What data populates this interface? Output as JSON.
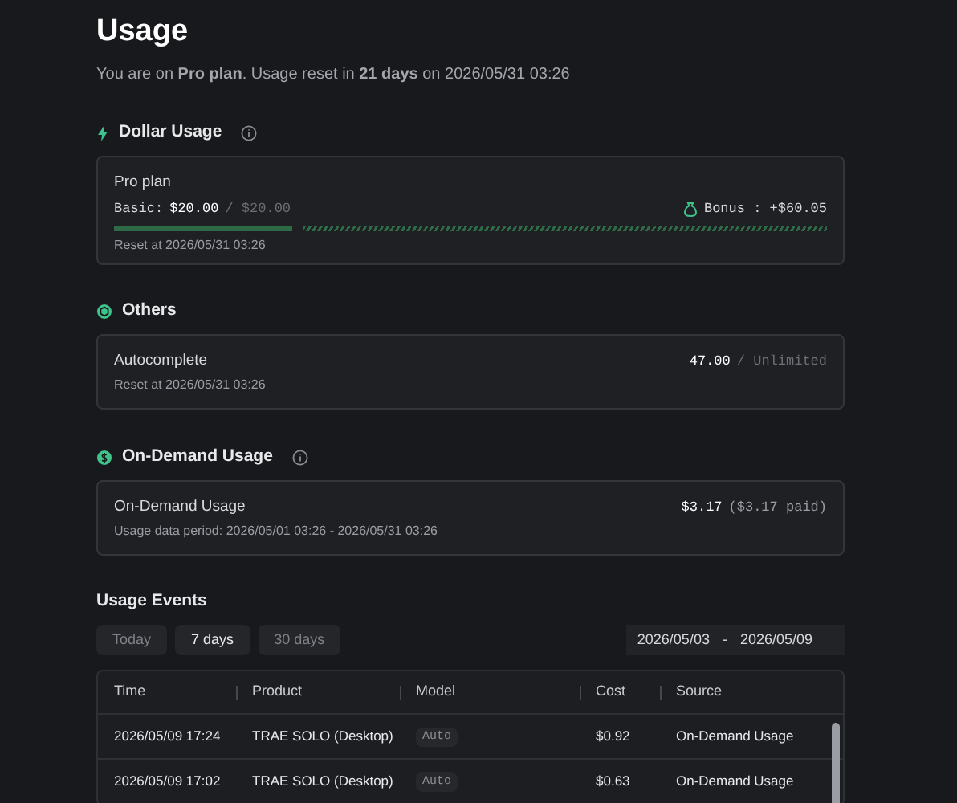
{
  "title": "Usage",
  "subtitle": "You are on **Pro plan**. Usage reset in **21 days** on 2026/05/31 03:26",
  "dollar_usage": {
    "heading": "Dollar Usage",
    "plan": "Pro plan",
    "basic_label": "Basic:",
    "basic_used": "$20.00",
    "basic_total": "/ $20.00",
    "bonus": "Bonus : +$60.05",
    "level": 0.25,
    "reset": "Reset at 2026/05/31 03:26"
  },
  "others": {
    "heading": "Others",
    "name": "Autocomplete",
    "used": "47.00",
    "limit": "/ Unlimited",
    "reset": "Reset at 2026/05/31 03:26"
  },
  "on_demand": {
    "heading": "On-Demand Usage",
    "name": "On-Demand Usage",
    "amount": "$3.17",
    "paid": "($3.17 paid)",
    "period": "Usage data period: 2026/05/01 03:26 - 2026/05/31 03:26"
  },
  "events": {
    "heading": "Usage Events",
    "ranges": [
      {
        "label": "Today",
        "selected": false
      },
      {
        "label": "7 days",
        "selected": true
      },
      {
        "label": "30 days",
        "selected": false
      }
    ],
    "date_from": "2026/05/03",
    "date_sep": "-",
    "date_to": "2026/05/09",
    "columns": [
      "Time",
      "Product",
      "Model",
      "Cost",
      "Source"
    ],
    "rows": [
      {
        "time": "2026/05/09 17:24",
        "product": "TRAE SOLO (Desktop)",
        "model": "Auto",
        "cost": "$0.92",
        "source": "On-Demand Usage"
      },
      {
        "time": "2026/05/09 17:02",
        "product": "TRAE SOLO (Desktop)",
        "model": "Auto",
        "cost": "$0.63",
        "source": "On-Demand Usage"
      }
    ]
  }
}
